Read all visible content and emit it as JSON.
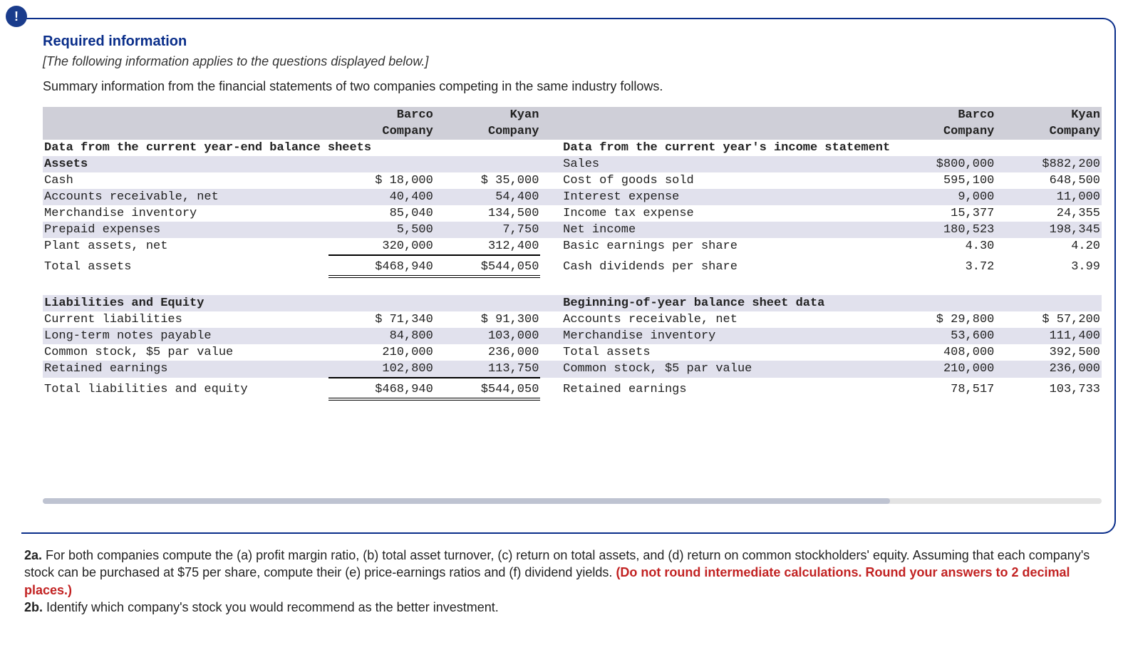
{
  "badge": "!",
  "header": {
    "required": "Required information",
    "note": "[The following information applies to the questions displayed below.]",
    "summary": "Summary information from the financial statements of two companies competing in the same industry follows."
  },
  "cols": {
    "barco": "Barco",
    "kyan": "Kyan",
    "company": "Company"
  },
  "left": {
    "title": "Data from the current year-end balance sheets",
    "assets": "Assets",
    "rows": [
      {
        "label": "Cash",
        "b": "$ 18,000",
        "k": "$ 35,000"
      },
      {
        "label": "Accounts receivable, net",
        "b": "40,400",
        "k": "54,400"
      },
      {
        "label": "Merchandise inventory",
        "b": "85,040",
        "k": "134,500"
      },
      {
        "label": "Prepaid expenses",
        "b": "5,500",
        "k": "7,750"
      },
      {
        "label": "Plant assets, net",
        "b": "320,000",
        "k": "312,400"
      }
    ],
    "total_assets": {
      "label": "Total assets",
      "b": "$468,940",
      "k": "$544,050"
    },
    "le": "Liabilities and Equity",
    "lrows": [
      {
        "label": "Current liabilities",
        "b": "$ 71,340",
        "k": "$ 91,300"
      },
      {
        "label": "Long-term notes payable",
        "b": "84,800",
        "k": "103,000"
      },
      {
        "label": "Common stock, $5 par value",
        "b": "210,000",
        "k": "236,000"
      },
      {
        "label": "Retained earnings",
        "b": "102,800",
        "k": "113,750"
      }
    ],
    "total_le": {
      "label": "Total liabilities and equity",
      "b": "$468,940",
      "k": "$544,050"
    }
  },
  "right": {
    "title": "Data from the current year's income statement",
    "rows": [
      {
        "label": "Sales",
        "b": "$800,000",
        "k": "$882,200"
      },
      {
        "label": "Cost of goods sold",
        "b": "595,100",
        "k": "648,500"
      },
      {
        "label": "Interest expense",
        "b": "9,000",
        "k": "11,000"
      },
      {
        "label": "Income tax expense",
        "b": "15,377",
        "k": "24,355"
      },
      {
        "label": "Net income",
        "b": "180,523",
        "k": "198,345"
      },
      {
        "label": "Basic earnings per share",
        "b": "4.30",
        "k": "4.20"
      },
      {
        "label": "Cash dividends per share",
        "b": "3.72",
        "k": "3.99"
      }
    ],
    "boy": "Beginning-of-year balance sheet data",
    "brows": [
      {
        "label": "Accounts receivable, net",
        "b": "$ 29,800",
        "k": "$ 57,200"
      },
      {
        "label": "Merchandise inventory",
        "b": "53,600",
        "k": "111,400"
      },
      {
        "label": "Total assets",
        "b": "408,000",
        "k": "392,500"
      },
      {
        "label": "Common stock, $5 par value",
        "b": "210,000",
        "k": "236,000"
      },
      {
        "label": "Retained earnings",
        "b": "78,517",
        "k": "103,733"
      }
    ]
  },
  "question": {
    "q2a_prefix": "2a.",
    "q2a_body1": " For both companies compute the (a) profit margin ratio, (b) total asset turnover, (c) return on total assets, and (d) return on common stockholders' equity. Assuming that each company's stock can be purchased at $75 per share, compute their (e) price-earnings ratios and (f) dividend yields. ",
    "q2a_red": "(Do not round intermediate calculations. Round your answers to 2 decimal places.)",
    "q2b_prefix": "2b.",
    "q2b_body": " Identify which company's stock you would recommend as the better investment."
  }
}
